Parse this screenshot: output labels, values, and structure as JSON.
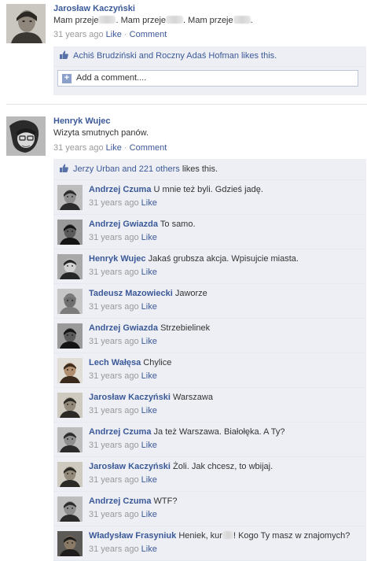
{
  "posts": [
    {
      "author": "Jarosław Kaczyński",
      "text_parts": [
        "Mam przeje",
        ". Mam przeje",
        ". Mam przeje",
        "."
      ],
      "time": "31 years ago",
      "like_label": "Like",
      "comment_label": "Comment",
      "likes_text": "Achiś Brudziński and Roczny Adaś Hofman likes this.",
      "add_comment_placeholder": "Add a comment....",
      "comments": []
    },
    {
      "author": "Henryk Wujec",
      "text": "Wizyta smutnych panów.",
      "time": "31 years ago",
      "like_label": "Like",
      "comment_label": "Comment",
      "likes_link": "Jerzy Urban and 221 others",
      "likes_suffix": "likes this.",
      "comments": [
        {
          "author": "Andrzej Czuma",
          "text": "U mnie też byli. Gdzieś jadę.",
          "time": "31 years ago",
          "like": "Like",
          "avatar": "face-a"
        },
        {
          "author": "Andrzej Gwiazda",
          "text": "To samo.",
          "time": "31 years ago",
          "like": "Like",
          "avatar": "face-b"
        },
        {
          "author": "Henryk Wujec",
          "text": "Jakaś grubsza akcja. Wpisujcie miasta.",
          "time": "31 years ago",
          "like": "Like",
          "avatar": "face-c"
        },
        {
          "author": "Tadeusz Mazowiecki",
          "text": "Jaworze",
          "time": "31 years ago",
          "like": "Like",
          "avatar": "face-d"
        },
        {
          "author": "Andrzej Gwiazda",
          "text": "Strzebielinek",
          "time": "31 years ago",
          "like": "Like",
          "avatar": "face-b"
        },
        {
          "author": "Lech Wałęsa",
          "text": "Chylice",
          "time": "31 years ago",
          "like": "Like",
          "avatar": "face-e"
        },
        {
          "author": "Jarosław Kaczyński",
          "text": "Warszawa",
          "time": "31 years ago",
          "like": "Like",
          "avatar": "face-f"
        },
        {
          "author": "Andrzej Czuma",
          "text": "Ja też Warszawa. Białołęka. A Ty?",
          "time": "31 years ago",
          "like": "Like",
          "avatar": "face-a"
        },
        {
          "author": "Jarosław Kaczyński",
          "text": "Żoli. Jak chcesz, to wbijaj.",
          "time": "31 years ago",
          "like": "Like",
          "avatar": "face-f"
        },
        {
          "author": "Andrzej Czuma",
          "text": "WTF?",
          "time": "31 years ago",
          "like": "Like",
          "avatar": "face-a"
        },
        {
          "author": "Władysław Frasyniuk",
          "text_parts": [
            "Heniek, kur",
            "! Kogo Ty masz w znajomych?"
          ],
          "time": "31 years ago",
          "like": "Like",
          "avatar": "face-g"
        }
      ]
    }
  ],
  "colors": {
    "link": "#3b5998",
    "ufi_bg": "#edeff4",
    "muted": "#999999"
  }
}
